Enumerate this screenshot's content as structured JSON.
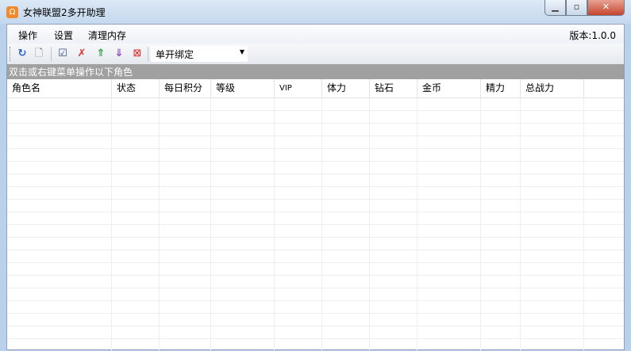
{
  "window": {
    "title": "女神联盟2多开助理",
    "icon": "app-icon",
    "controls": [
      "minimize",
      "maximize",
      "close"
    ]
  },
  "menu": {
    "items": [
      "操作",
      "设置",
      "清理内存"
    ],
    "version": "版本:1.0.0"
  },
  "toolbar": {
    "icons": [
      "refresh-icon",
      "new-document-icon",
      "check-icon",
      "uncheck-icon",
      "move-up-icon",
      "move-down-icon",
      "delete-icon"
    ],
    "combo_value": "单开绑定"
  },
  "hint": "双击或右键菜单操作以下角色",
  "table": {
    "columns": [
      "角色名",
      "状态",
      "每日积分",
      "等级",
      "VIP",
      "体力",
      "钻石",
      "金币",
      "精力",
      "总战力",
      ""
    ],
    "rows": []
  }
}
